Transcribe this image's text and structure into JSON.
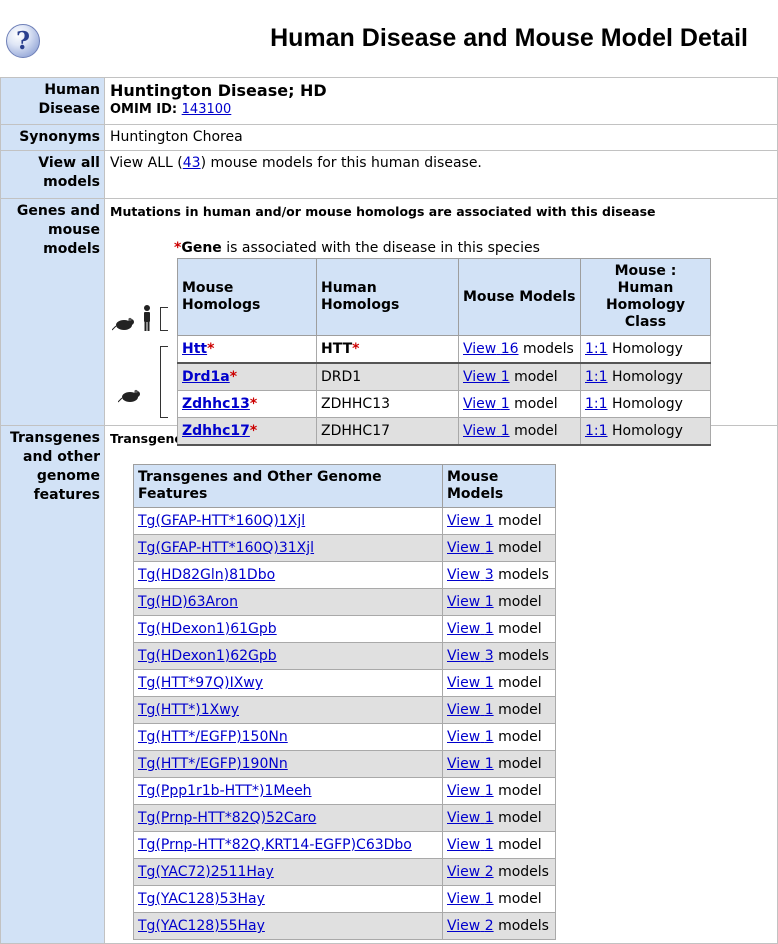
{
  "page": {
    "title": "Human Disease and Mouse Model Detail",
    "help_glyph": "?"
  },
  "disease": {
    "label": "Human Disease",
    "name": "Huntington Disease; HD",
    "omim_label": "OMIM ID:",
    "omim_id": "143100"
  },
  "synonyms": {
    "label": "Synonyms",
    "value": "Huntington Chorea"
  },
  "view_all": {
    "label": "View all models",
    "prefix": "View ALL (",
    "count": "43",
    "suffix": ") mouse models for this human disease."
  },
  "genes": {
    "label": "Genes and mouse models",
    "subhead": "Mutations in human and/or mouse homologs are associated with this disease",
    "note_star": "*",
    "note_gene": "Gene",
    "note_rest": " is associated with the disease in this species",
    "headers": [
      "Mouse Homologs",
      "Human Homologs",
      "Mouse Models",
      "Mouse : Human Homology Class"
    ],
    "rows": [
      {
        "mouse": "Htt",
        "mouse_star": "*",
        "human": "HTT",
        "human_star": "*",
        "view": "View",
        "count": "16",
        "unit": "models",
        "class_link": "1:1",
        "class_text": "Homology"
      },
      {
        "mouse": "Drd1a",
        "mouse_star": "*",
        "human": "DRD1",
        "human_star": "",
        "view": "View",
        "count": "1",
        "unit": "model",
        "class_link": "1:1",
        "class_text": "Homology"
      },
      {
        "mouse": "Zdhhc13",
        "mouse_star": "*",
        "human": "ZDHHC13",
        "human_star": "",
        "view": "View",
        "count": "1",
        "unit": "model",
        "class_link": "1:1",
        "class_text": "Homology"
      },
      {
        "mouse": "Zdhhc17",
        "mouse_star": "*",
        "human": "ZDHHC17",
        "human_star": "",
        "view": "View",
        "count": "1",
        "unit": "model",
        "class_link": "1:1",
        "class_text": "Homology"
      }
    ]
  },
  "transgenes": {
    "label": "Transgenes and other genome features",
    "subhead": "Transgenes and other genome features developed in mice to model this disease.",
    "headers": [
      "Transgenes and Other Genome Features",
      "Mouse Models"
    ],
    "rows": [
      {
        "name": "Tg(GFAP-HTT*160Q)1Xjl",
        "view": "View",
        "count": "1",
        "unit": "model"
      },
      {
        "name": "Tg(GFAP-HTT*160Q)31Xjl",
        "view": "View",
        "count": "1",
        "unit": "model"
      },
      {
        "name": "Tg(HD82Gln)81Dbo",
        "view": "View",
        "count": "3",
        "unit": "models"
      },
      {
        "name": "Tg(HD)63Aron",
        "view": "View",
        "count": "1",
        "unit": "model"
      },
      {
        "name": "Tg(HDexon1)61Gpb",
        "view": "View",
        "count": "1",
        "unit": "model"
      },
      {
        "name": "Tg(HDexon1)62Gpb",
        "view": "View",
        "count": "3",
        "unit": "models"
      },
      {
        "name": "Tg(HTT*97Q)IXwy",
        "view": "View",
        "count": "1",
        "unit": "model"
      },
      {
        "name": "Tg(HTT*)1Xwy",
        "view": "View",
        "count": "1",
        "unit": "model"
      },
      {
        "name": "Tg(HTT*/EGFP)150Nn",
        "view": "View",
        "count": "1",
        "unit": "model"
      },
      {
        "name": "Tg(HTT*/EGFP)190Nn",
        "view": "View",
        "count": "1",
        "unit": "model"
      },
      {
        "name": "Tg(Ppp1r1b-HTT*)1Meeh",
        "view": "View",
        "count": "1",
        "unit": "model"
      },
      {
        "name": "Tg(Prnp-HTT*82Q)52Caro",
        "view": "View",
        "count": "1",
        "unit": "model"
      },
      {
        "name": "Tg(Prnp-HTT*82Q,KRT14-EGFP)C63Dbo",
        "view": "View",
        "count": "1",
        "unit": "model"
      },
      {
        "name": "Tg(YAC72)2511Hay",
        "view": "View",
        "count": "2",
        "unit": "models"
      },
      {
        "name": "Tg(YAC128)53Hay",
        "view": "View",
        "count": "1",
        "unit": "model"
      },
      {
        "name": "Tg(YAC128)55Hay",
        "view": "View",
        "count": "2",
        "unit": "models"
      }
    ]
  },
  "colors": {
    "label_bg": "#d2e2f6",
    "link": "#0000cc",
    "star": "#cc0000",
    "shade": "#e0e0e0"
  },
  "icons": {
    "help": "help-icon",
    "mouse": "mouse-icon",
    "person": "person-icon"
  }
}
